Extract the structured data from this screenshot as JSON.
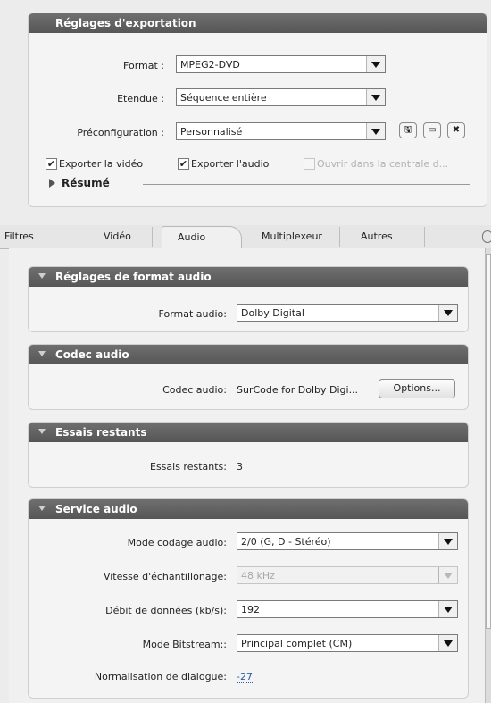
{
  "export_settings": {
    "title": "Réglages d'exportation",
    "format_label": "Format :",
    "format_value": "MPEG2-DVD",
    "range_label": "Etendue :",
    "range_value": "Séquence entière",
    "preset_label": "Préconfiguration :",
    "preset_value": "Personnalisé",
    "export_video_label": "Exporter la vidéo",
    "export_video_checked": true,
    "export_audio_label": "Exporter l'audio",
    "export_audio_checked": true,
    "open_in_label": "Ouvrir dans la centrale d...",
    "open_in_checked": false,
    "summary_label": "Résumé"
  },
  "tabs": [
    "Filtres",
    "Vidéo",
    "Audio",
    "Multiplexeur",
    "Autres"
  ],
  "active_tab": "Audio",
  "sections": {
    "audio_format": {
      "title": "Réglages de format audio",
      "format_label": "Format audio:",
      "format_value": "Dolby Digital"
    },
    "audio_codec": {
      "title": "Codec audio",
      "codec_label": "Codec audio:",
      "codec_value": "SurCode for Dolby Digi...",
      "options_button": "Options..."
    },
    "trials": {
      "title": "Essais restants",
      "label": "Essais restants:",
      "value": "3"
    },
    "audio_service": {
      "title": "Service audio",
      "coding_mode_label": "Mode codage audio:",
      "coding_mode_value": "2/0 (G, D - Stéréo)",
      "sample_rate_label": "Vitesse d'échantillonage:",
      "sample_rate_value": "48 kHz",
      "bitrate_label": "Débit de données (kb/s):",
      "bitrate_value": "192",
      "bitstream_label": "Mode Bitstream::",
      "bitstream_value": "Principal complet (CM)",
      "dialnorm_label": "Normalisation de dialogue:",
      "dialnorm_value": "-27"
    }
  },
  "colors": {
    "section_header": "#5f5f5f",
    "link_value": "#2b5fa8"
  }
}
